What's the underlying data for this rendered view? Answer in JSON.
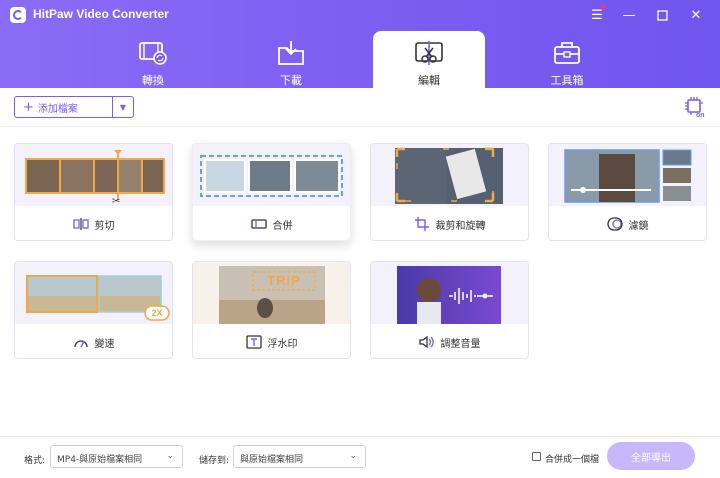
{
  "app": {
    "title": "HitPaw Video Converter"
  },
  "tabs": [
    {
      "label": "轉換",
      "icon": "film-convert-icon"
    },
    {
      "label": "下載",
      "icon": "download-folder-icon"
    },
    {
      "label": "編輯",
      "icon": "edit-cut-icon",
      "active": true
    },
    {
      "label": "工具箱",
      "icon": "toolbox-icon"
    }
  ],
  "toolbar": {
    "add_label": "添加檔案"
  },
  "tools": [
    {
      "label": "剪切",
      "icon": "cut-icon"
    },
    {
      "label": "合併",
      "icon": "merge-icon"
    },
    {
      "label": "裁剪和旋轉",
      "icon": "crop-icon"
    },
    {
      "label": "濾鏡",
      "icon": "filter-icon"
    },
    {
      "label": "變速",
      "icon": "speed-icon",
      "badge": "2X"
    },
    {
      "label": "浮水印",
      "icon": "watermark-icon",
      "watermark_text": "TRIP"
    },
    {
      "label": "調整音量",
      "icon": "volume-icon"
    }
  ],
  "footer": {
    "format_label": "格式:",
    "format_value": "MP4-與原始檔案相同",
    "save_label": "儲存到:",
    "save_value": "與原始檔案相同",
    "merge_label": "合併成一個檔",
    "export_label": "全部導出"
  },
  "colors": {
    "accent": "#7a5cf0",
    "export_disabled": "#c6b8fb"
  }
}
